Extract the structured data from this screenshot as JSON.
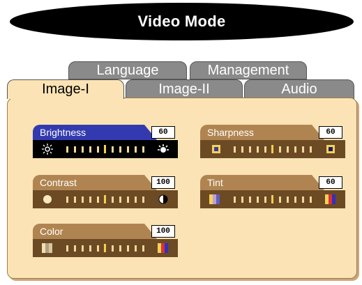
{
  "title": "Video Mode",
  "tabs": {
    "back": [
      {
        "label": "Language"
      },
      {
        "label": "Management"
      }
    ],
    "front": [
      {
        "label": "Image-I",
        "active": true
      },
      {
        "label": "Image-II",
        "active": false
      },
      {
        "label": "Audio",
        "active": false
      }
    ]
  },
  "controls": {
    "brightness": {
      "label": "Brightness",
      "value": "60",
      "selected": true,
      "left_icon": "sun-dim-icon",
      "right_icon": "sun-bright-icon"
    },
    "contrast": {
      "label": "Contrast",
      "value": "100",
      "selected": false,
      "left_icon": "circle-icon",
      "right_icon": "half-circle-icon"
    },
    "color": {
      "label": "Color",
      "value": "100",
      "selected": false,
      "left_icon": "gray-bars-icon",
      "right_icon": "color-bars-icon"
    },
    "sharpness": {
      "label": "Sharpness",
      "value": "60",
      "selected": false,
      "left_icon": "soft-square-icon",
      "right_icon": "sharp-square-icon"
    },
    "tint": {
      "label": "Tint",
      "value": "60",
      "selected": false,
      "left_icon": "tint-low-icon",
      "right_icon": "tint-high-icon"
    }
  },
  "colors": {
    "panel": "#fbe3b5",
    "header": "#b08450",
    "selected_header": "#333ab0",
    "bar": "#6b4a24"
  }
}
